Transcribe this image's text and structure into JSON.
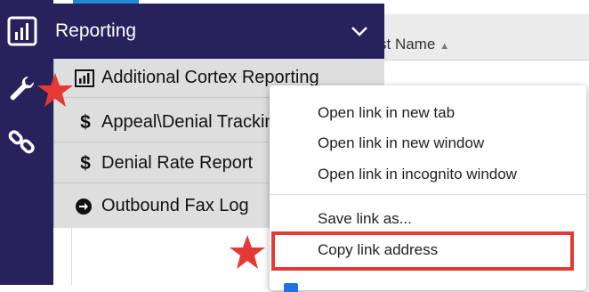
{
  "nav": {
    "header_label": "Reporting",
    "items": [
      {
        "icon": "bar-chart-icon",
        "glyph": "",
        "label": "Additional Cortex Reporting"
      },
      {
        "icon": "dollar-icon",
        "glyph": "$",
        "label": "Appeal\\Denial Trackin"
      },
      {
        "icon": "dollar-icon",
        "glyph": "$",
        "label": "Denial Rate Report"
      },
      {
        "icon": "arrow-circle-right-icon",
        "glyph": "",
        "label": "Outbound Fax Log"
      }
    ]
  },
  "rail_icons": [
    "dashboard-chart-icon",
    "wrench-icon",
    "link-icon"
  ],
  "table": {
    "header_text": "st Name",
    "sort_indicator": "▲"
  },
  "context_menu": {
    "items": [
      "Open link in new tab",
      "Open link in new window",
      "Open link in incognito window",
      "Save link as...",
      "Copy link address"
    ]
  },
  "colors": {
    "nav_bg": "#27215c",
    "submenu_bg": "#dedede",
    "highlight": "#e53935",
    "star": "#e53935",
    "accent": "#1f8ad6"
  }
}
